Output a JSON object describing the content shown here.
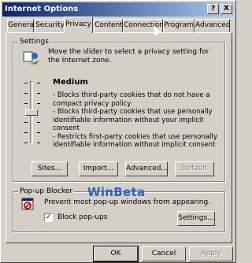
{
  "window": {
    "title": "Internet Options",
    "help_label": "?",
    "close_label": "X"
  },
  "tabs": [
    {
      "label": "General"
    },
    {
      "label": "Security"
    },
    {
      "label": "Privacy",
      "active": true
    },
    {
      "label": "Content"
    },
    {
      "label": "Connections"
    },
    {
      "label": "Programs"
    },
    {
      "label": "Advanced"
    }
  ],
  "settings": {
    "group_title": "Settings",
    "intro": "Move the slider to select a privacy setting for the Internet zone.",
    "level": "Medium",
    "bullets": [
      "- Blocks third-party cookies that do not have a compact privacy policy",
      "- Blocks third-party cookies that use personally identifiable information without your implicit consent",
      "- Restricts first-party cookies that use personally identifiable information without implicit consent"
    ],
    "buttons": {
      "sites": "Sites...",
      "import": "Import...",
      "advanced": "Advanced...",
      "default": "Default"
    }
  },
  "popup": {
    "group_title": "Pop-up Blocker",
    "watermark": "WinBeta",
    "description": "Prevent most pop-up windows from appearing.",
    "checkbox_label": "Block pop-ups",
    "checkbox_checked": true,
    "settings_button": "Settings..."
  },
  "footer": {
    "ok": "OK",
    "cancel": "Cancel",
    "apply": "Apply"
  },
  "colors": {
    "title_bar_start": "#0a246a",
    "title_bar_end": "#a6caf0",
    "face": "#d4d0c8",
    "watermark": "#2a63c7"
  }
}
